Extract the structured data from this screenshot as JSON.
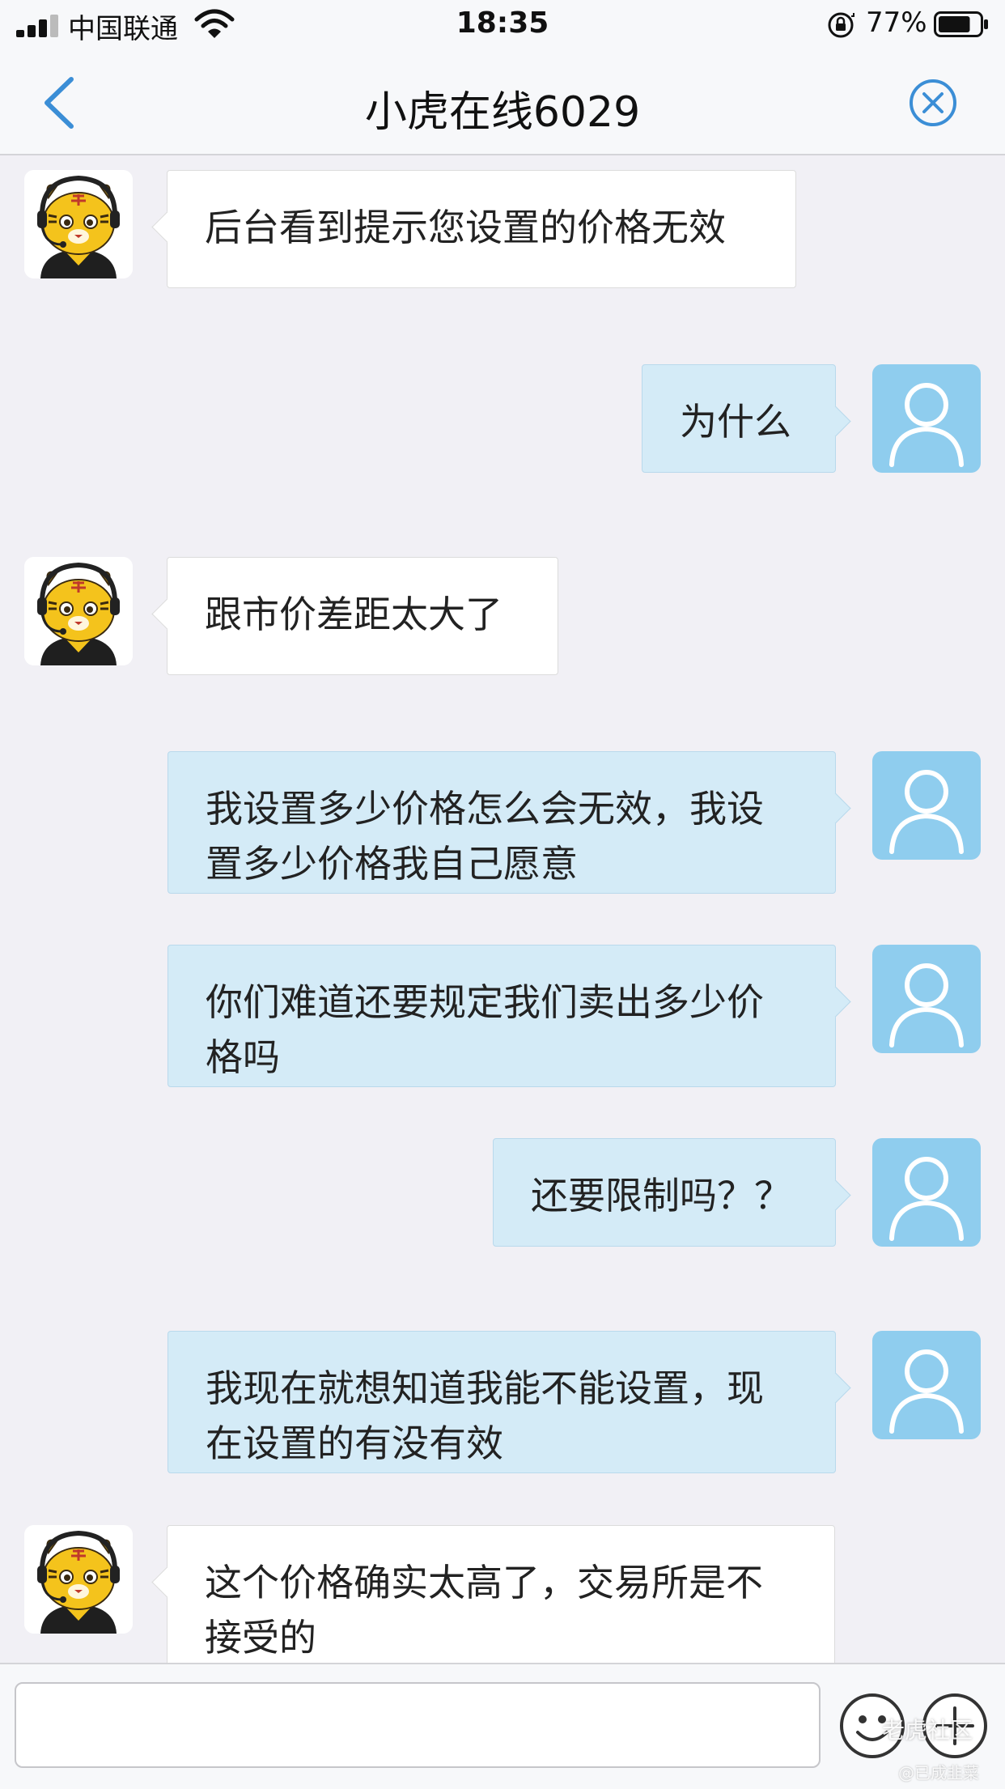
{
  "status_bar": {
    "carrier": "中国联通",
    "time": "18:35",
    "battery_percent": "77%",
    "battery_level": 0.77,
    "icons": [
      "signal-icon",
      "wifi-icon",
      "orientation-lock-icon",
      "battery-icon"
    ]
  },
  "nav": {
    "title": "小虎在线6029",
    "back_icon": "chevron-left-icon",
    "close_icon": "close-circle-icon"
  },
  "colors": {
    "agent_bubble": "#ffffff",
    "user_bubble": "#d4ebf7",
    "accent": "#3b8ed6",
    "user_avatar": "#8fcdee"
  },
  "messages": [
    {
      "sender": "agent",
      "text": "后台看到提示您设置的价格无效"
    },
    {
      "sender": "user",
      "text": "为什么"
    },
    {
      "sender": "agent",
      "text": "跟市价差距太大了"
    },
    {
      "sender": "user",
      "text": "我设置多少价格怎么会无效，我设置多少价格我自己愿意"
    },
    {
      "sender": "user",
      "text": "你们难道还要规定我们卖出多少价格吗"
    },
    {
      "sender": "user",
      "text": "还要限制吗？？"
    },
    {
      "sender": "user",
      "text": "我现在就想知道我能不能设置，现在设置的有没有效"
    },
    {
      "sender": "agent",
      "text": "这个价格确实太高了，交易所是不接受的"
    }
  ],
  "input_bar": {
    "value": "",
    "placeholder": "",
    "emoji_icon": "emoji-icon",
    "plus_icon": "plus-icon"
  },
  "watermark": {
    "brand": "老虎社区",
    "handle": "@已成韭菜"
  }
}
